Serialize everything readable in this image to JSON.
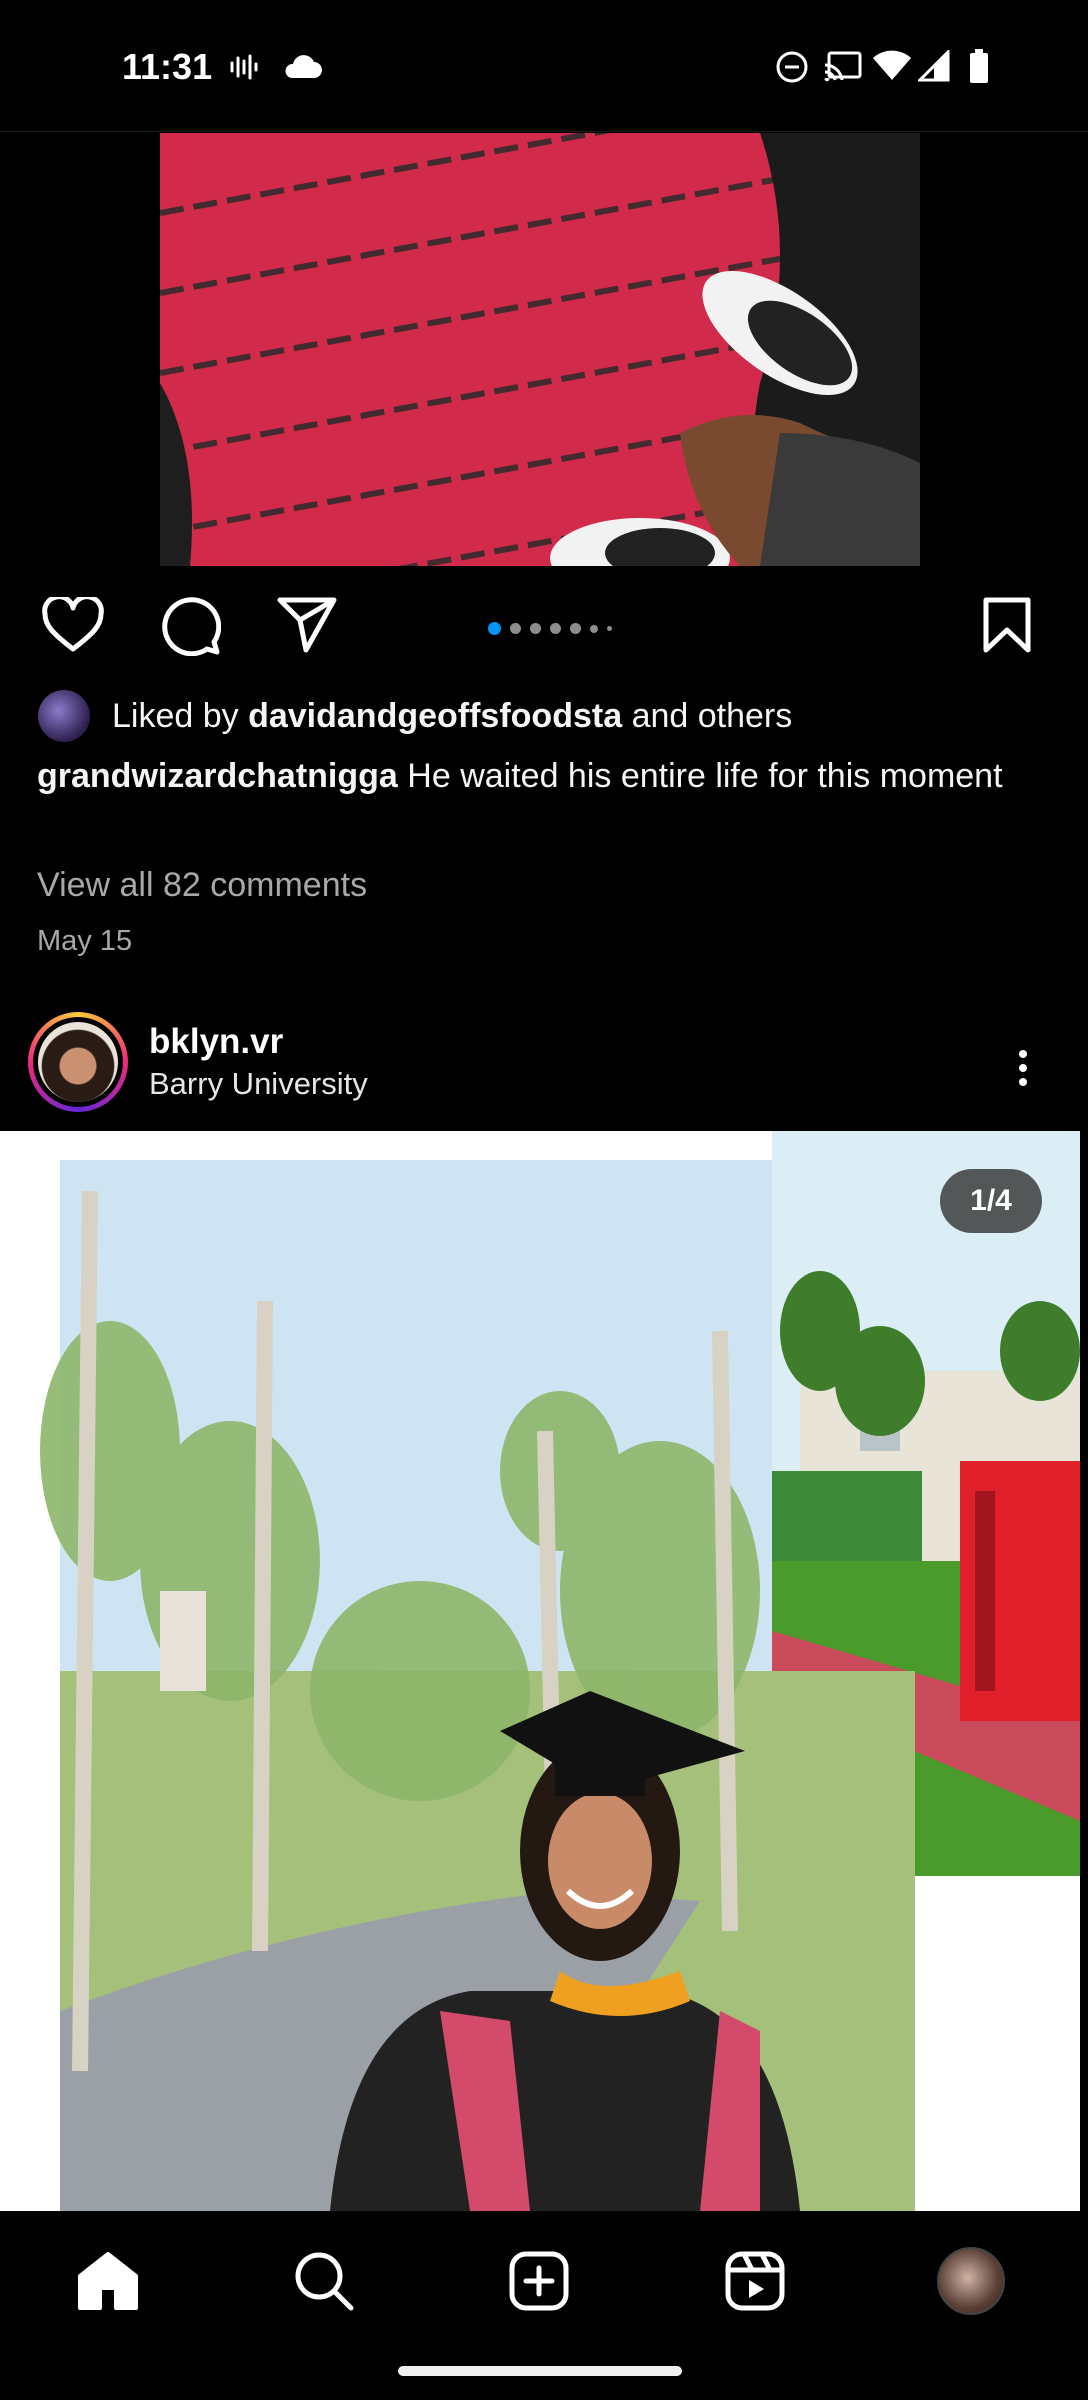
{
  "status_bar": {
    "time": "11:31",
    "icons": [
      "voicemail-icon",
      "cloud-icon",
      "do-not-disturb-icon",
      "cast-icon",
      "wifi-icon",
      "signal-icon",
      "battery-icon"
    ]
  },
  "post1": {
    "carousel_dots_total": 7,
    "carousel_dots_active": 1,
    "liked_by_prefix": "Liked by",
    "liked_by_user": "davidandgeoffsfoodsta",
    "liked_by_suffix": "and others",
    "caption_user": "grandwizardchatnigga",
    "caption_text": "He waited his entire life for this moment",
    "view_comments": "View all 82 comments",
    "date": "May 15"
  },
  "post2": {
    "username": "bklyn.vr",
    "location": "Barry University",
    "counter": "1/4"
  },
  "colors": {
    "background": "#000000",
    "accent_blue": "#0095f6",
    "muted_text": "#a8a8a8"
  },
  "bottom_nav": [
    "home-icon",
    "search-icon",
    "create-icon",
    "reels-icon",
    "profile-avatar"
  ]
}
